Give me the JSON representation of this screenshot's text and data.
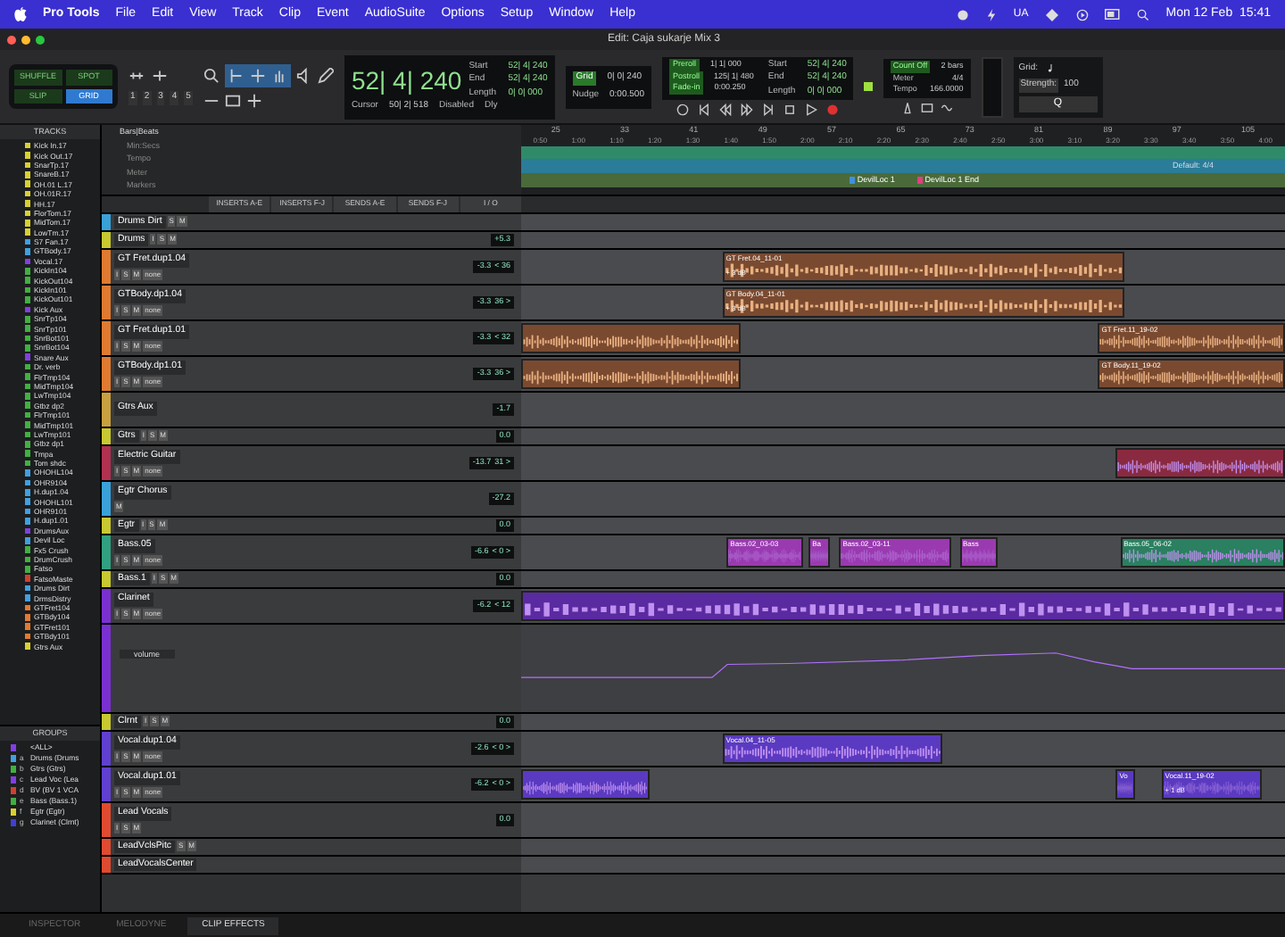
{
  "menubar": {
    "app": "Pro Tools",
    "menus": [
      "File",
      "Edit",
      "View",
      "Track",
      "Clip",
      "Event",
      "AudioSuite",
      "Options",
      "Setup",
      "Window",
      "Help"
    ],
    "status_text": "UA",
    "clock": "Mon 12 Feb  15:41"
  },
  "window": {
    "title": "Edit: Caja sukarje Mix 3"
  },
  "toolbar": {
    "modes": [
      {
        "label": "SHUFFLE",
        "selected": false
      },
      {
        "label": "SPOT",
        "selected": false
      },
      {
        "label": "SLIP",
        "selected": false
      },
      {
        "label": "GRID",
        "selected": true
      }
    ],
    "zoom_presets": [
      "1",
      "2",
      "3",
      "4",
      "5"
    ],
    "main_counter": "52| 4| 240",
    "selection": [
      {
        "label": "Start",
        "value": "52| 4| 240"
      },
      {
        "label": "End",
        "value": "52| 4| 240"
      },
      {
        "label": "Length",
        "value": "0| 0| 000"
      }
    ],
    "cursor": {
      "label": "Cursor",
      "value": "50| 2| 518"
    },
    "delay": {
      "state": "Disabled",
      "label": "Dly"
    },
    "grid": {
      "label": "Grid",
      "value": "0| 0| 240"
    },
    "nudge": {
      "label": "Nudge",
      "value": "0:00.500"
    },
    "rolls": [
      {
        "label": "Preroll",
        "value": "1| 1| 000"
      },
      {
        "label": "Postroll",
        "value": "125| 1| 480"
      },
      {
        "label": "Fade-in",
        "value": "0:00.250"
      }
    ],
    "range": [
      {
        "label": "Start",
        "value": "52| 4| 240"
      },
      {
        "label": "End",
        "value": "52| 4| 240"
      },
      {
        "label": "Length",
        "value": "0| 0| 000"
      }
    ],
    "count_off": {
      "label": "Count Off",
      "value": "2 bars"
    },
    "meter": {
      "label": "Meter",
      "value": "4/4"
    },
    "tempo": {
      "label": "Tempo",
      "value": "166.0000"
    },
    "quantize": {
      "grid_label": "Grid:",
      "strength_label": "Strength:",
      "strength": "100",
      "button": "Q"
    }
  },
  "tracks_list": {
    "title": "TRACKS",
    "items": [
      {
        "name": "Kick In.17",
        "color": "#d8d030"
      },
      {
        "name": "Kick Out.17",
        "color": "#d8d030"
      },
      {
        "name": "SnarTp.17",
        "color": "#d8d030"
      },
      {
        "name": "SnareB.17",
        "color": "#d8d030"
      },
      {
        "name": "OH.01 L.17",
        "color": "#d8d030"
      },
      {
        "name": "OH.01R.17",
        "color": "#d8d030"
      },
      {
        "name": "HH.17",
        "color": "#d8d030"
      },
      {
        "name": "FlorTom.17",
        "color": "#d8d030"
      },
      {
        "name": "MidTom.17",
        "color": "#d8d030"
      },
      {
        "name": "LowTm.17",
        "color": "#d8d030"
      },
      {
        "name": "S7 Fan.17",
        "color": "#40a0e0"
      },
      {
        "name": "GTBody.17",
        "color": "#40a0e0"
      },
      {
        "name": "Vocal.17",
        "color": "#8040e0"
      },
      {
        "name": "KickIn104",
        "color": "#40b040"
      },
      {
        "name": "KickOut104",
        "color": "#40b040"
      },
      {
        "name": "KickIn101",
        "color": "#40b040"
      },
      {
        "name": "KickOut101",
        "color": "#40b040"
      },
      {
        "name": "Kick Aux",
        "color": "#8040e0"
      },
      {
        "name": "SnrTp104",
        "color": "#40b040"
      },
      {
        "name": "SnrTp101",
        "color": "#40b040"
      },
      {
        "name": "SnrBot101",
        "color": "#40b040"
      },
      {
        "name": "SnrBot104",
        "color": "#40b040"
      },
      {
        "name": "Snare Aux",
        "color": "#8040e0"
      },
      {
        "name": "Dr. verb",
        "color": "#40b040"
      },
      {
        "name": "FlrTmp104",
        "color": "#40b040"
      },
      {
        "name": "MidTmp104",
        "color": "#40b040"
      },
      {
        "name": "LwTmp104",
        "color": "#40b040"
      },
      {
        "name": "Gtbz dp2",
        "color": "#40b040"
      },
      {
        "name": "FlrTmp101",
        "color": "#40b040"
      },
      {
        "name": "MidTmp101",
        "color": "#40b040"
      },
      {
        "name": "LwTmp101",
        "color": "#40b040"
      },
      {
        "name": "Gtbz dp1",
        "color": "#40b040"
      },
      {
        "name": "Tmpa",
        "color": "#40b040"
      },
      {
        "name": "Tom shdc",
        "color": "#40b040"
      },
      {
        "name": "OHOHL104",
        "color": "#40a0e0"
      },
      {
        "name": "OHR9104",
        "color": "#40a0e0"
      },
      {
        "name": "H.dup1.04",
        "color": "#40a0e0"
      },
      {
        "name": "OHOHL101",
        "color": "#40a0e0"
      },
      {
        "name": "OHR9101",
        "color": "#40a0e0"
      },
      {
        "name": "H.dup1.01",
        "color": "#40a0e0"
      },
      {
        "name": "DrumsAux",
        "color": "#8040e0"
      },
      {
        "name": "Devil Loc",
        "color": "#40a0e0"
      },
      {
        "name": "Fx5 Crush",
        "color": "#40b040"
      },
      {
        "name": "DrumCrush",
        "color": "#40b040"
      },
      {
        "name": "Fatso",
        "color": "#40b040"
      },
      {
        "name": "FatsoMaste",
        "color": "#d04030"
      },
      {
        "name": "Drums Dirt",
        "color": "#40a0e0"
      },
      {
        "name": "DrmsDistry",
        "color": "#40a0e0"
      },
      {
        "name": "GTFret104",
        "color": "#e07a30"
      },
      {
        "name": "GTBdy104",
        "color": "#e07a30"
      },
      {
        "name": "GTFret101",
        "color": "#e07a30"
      },
      {
        "name": "GTBdy101",
        "color": "#e07a30"
      },
      {
        "name": "Gtrs Aux",
        "color": "#d8d030"
      }
    ]
  },
  "groups": {
    "title": "GROUPS",
    "items": [
      {
        "name": "<ALL>",
        "color": "#8040e0"
      },
      {
        "id": "a",
        "name": "Drums (Drums",
        "color": "#40a0e0"
      },
      {
        "id": "b",
        "name": "Gtrs (Gtrs)",
        "color": "#40b040"
      },
      {
        "id": "c",
        "name": "Lead Voc (Lea",
        "color": "#8040e0"
      },
      {
        "id": "d",
        "name": "BV (BV 1 VCA",
        "color": "#d04030"
      },
      {
        "id": "e",
        "name": "Bass (Bass.1)",
        "color": "#40b040"
      },
      {
        "id": "f",
        "name": "Egtr (Egtr)",
        "color": "#d8d030"
      },
      {
        "id": "g",
        "name": "Clarinet (Clrnt)",
        "color": "#4040d0"
      }
    ]
  },
  "rulers": {
    "labels": [
      "Bars|Beats",
      "Min:Secs",
      "Tempo",
      "Meter",
      "Markers"
    ],
    "bars": [
      "25",
      "33",
      "41",
      "49",
      "57",
      "65",
      "73",
      "81",
      "89",
      "97",
      "105"
    ],
    "times": [
      "0:50",
      "1:00",
      "1:10",
      "1:20",
      "1:30",
      "1:40",
      "1:50",
      "2:00",
      "2:10",
      "2:20",
      "2:30",
      "2:40",
      "2:50",
      "3:00",
      "3:10",
      "3:20",
      "3:30",
      "3:40",
      "3:50",
      "4:00"
    ],
    "meter": "Default: 4/4",
    "markers": [
      {
        "name": "DevilLoc 1",
        "color": "#4090e0"
      },
      {
        "name": "DevilLoc 1 End",
        "color": "#e04080"
      }
    ]
  },
  "columns": [
    "INSERTS A-E",
    "INSERTS F-J",
    "SENDS A-E",
    "SENDS F-J",
    "I / O"
  ],
  "tracks": [
    {
      "name": "Drums Dirt",
      "kind": "folder",
      "color": "#3aa0d8",
      "buttons": [
        "S",
        "M"
      ]
    },
    {
      "name": "Drums",
      "kind": "folder",
      "color": "#c8c830",
      "buttons": [
        "I",
        "S",
        "M"
      ],
      "volume": "+5.3"
    },
    {
      "name": "GT Fret.dup1.04",
      "kind": "audio",
      "color": "#e07a30",
      "buttons": [
        "I",
        "S",
        "M"
      ],
      "voice": "none",
      "volume": "-3.3",
      "pan": "< 36",
      "clips": [
        {
          "name": "GT Fret.04_11-01",
          "gain": "+ 3 dB",
          "color": "#7a4a30"
        }
      ]
    },
    {
      "name": "GTBody.dp1.04",
      "kind": "audio",
      "color": "#e07a30",
      "buttons": [
        "I",
        "S",
        "M"
      ],
      "voice": "none",
      "volume": "-3.3",
      "pan": "36 >",
      "clips": [
        {
          "name": "GT Body.04_11-01",
          "gain": "+ 3 dB",
          "color": "#7a4a30"
        }
      ]
    },
    {
      "name": "GT Fret.dup1.01",
      "kind": "audio",
      "color": "#e07a30",
      "buttons": [
        "I",
        "S",
        "M"
      ],
      "voice": "none",
      "volume": "-3.3",
      "pan": "< 32",
      "clips": [
        {
          "color": "#7a4a30"
        },
        {
          "name": "GT Fret.11_19-02",
          "color": "#7a4a30"
        }
      ]
    },
    {
      "name": "GTBody.dp1.01",
      "kind": "audio",
      "color": "#e07a30",
      "buttons": [
        "I",
        "S",
        "M"
      ],
      "voice": "none",
      "volume": "-3.3",
      "pan": "36 >",
      "clips": [
        {
          "color": "#7a4a30"
        },
        {
          "name": "GT Body.11_19-02",
          "color": "#7a4a30"
        }
      ]
    },
    {
      "name": "Gtrs Aux",
      "kind": "aux",
      "color": "#c8a040",
      "volume": "-1.7"
    },
    {
      "name": "Gtrs",
      "kind": "folder",
      "color": "#c8c830",
      "buttons": [
        "I",
        "S",
        "M"
      ],
      "volume": "0.0"
    },
    {
      "name": "Electric Guitar",
      "kind": "audio",
      "color": "#b03050",
      "buttons": [
        "I",
        "S",
        "M"
      ],
      "voice": "none",
      "volume": "-13.7",
      "pan": "31 >",
      "clips": [
        {
          "color": "#8a2a40"
        }
      ]
    },
    {
      "name": "Egtr Chorus",
      "kind": "aux",
      "color": "#3aa0d8",
      "buttons": [
        "M"
      ],
      "volume": "-27.2"
    },
    {
      "name": "Egtr",
      "kind": "folder",
      "color": "#c8c830",
      "buttons": [
        "I",
        "S",
        "M"
      ],
      "volume": "0.0"
    },
    {
      "name": "Bass.05",
      "kind": "audio",
      "color": "#30a080",
      "buttons": [
        "I",
        "S",
        "M"
      ],
      "voice": "none",
      "volume": "-6.6",
      "pan": "< 0 >",
      "clips": [
        {
          "name": "Bass.02_03-03",
          "color": "#9a3ab0"
        },
        {
          "name": "Ba",
          "color": "#9a3ab0"
        },
        {
          "name": "Bass.02_03-11",
          "color": "#9a3ab0"
        },
        {
          "name": "Bass",
          "color": "#9a3ab0"
        },
        {
          "name": "Bass.05_06-02",
          "color": "#2a8060"
        }
      ]
    },
    {
      "name": "Bass.1",
      "kind": "folder",
      "color": "#c8c830",
      "buttons": [
        "I",
        "S",
        "M"
      ],
      "volume": "0.0"
    },
    {
      "name": "Clarinet",
      "kind": "audio",
      "color": "#7a30d0",
      "buttons": [
        "I",
        "S",
        "M"
      ],
      "voice": "none",
      "volume": "-6.2",
      "pan": "< 12",
      "automation": "volume",
      "clips": [
        {
          "color": "#5a2aa0"
        }
      ]
    },
    {
      "name": "Clrnt",
      "kind": "folder",
      "color": "#c8c830",
      "buttons": [
        "I",
        "S",
        "M"
      ],
      "volume": "0.0"
    },
    {
      "name": "Vocal.dup1.04",
      "kind": "audio",
      "color": "#6040d0",
      "buttons": [
        "I",
        "S",
        "M"
      ],
      "voice": "none",
      "volume": "-2.6",
      "pan": "< 0 >",
      "clips": [
        {
          "name": "Vocal.04_11-05",
          "color": "#5a3ac0"
        }
      ]
    },
    {
      "name": "Vocal.dup1.01",
      "kind": "audio",
      "color": "#6040d0",
      "buttons": [
        "I",
        "S",
        "M"
      ],
      "voice": "none",
      "volume": "-6.2",
      "pan": "< 0 >",
      "clips": [
        {
          "color": "#5a3ac0"
        },
        {
          "name": "Vo",
          "color": "#5a3ac0"
        },
        {
          "name": "Vocal.11_19-02",
          "gain": "+ 1 dB",
          "color": "#5a3ac0"
        }
      ]
    },
    {
      "name": "Lead Vocals",
      "kind": "aux",
      "color": "#e04a30",
      "buttons": [
        "I",
        "S",
        "M"
      ],
      "volume": "0.0"
    },
    {
      "name": "LeadVclsPitc",
      "kind": "folder",
      "color": "#e04a30",
      "buttons": [
        "S",
        "M"
      ]
    },
    {
      "name": "LeadVocalsCenter",
      "kind": "folder",
      "color": "#e04a30"
    }
  ],
  "bottom_tabs": [
    {
      "label": "INSPECTOR",
      "selected": false
    },
    {
      "label": "MELODYNE",
      "selected": false
    },
    {
      "label": "CLIP EFFECTS",
      "selected": true
    }
  ]
}
